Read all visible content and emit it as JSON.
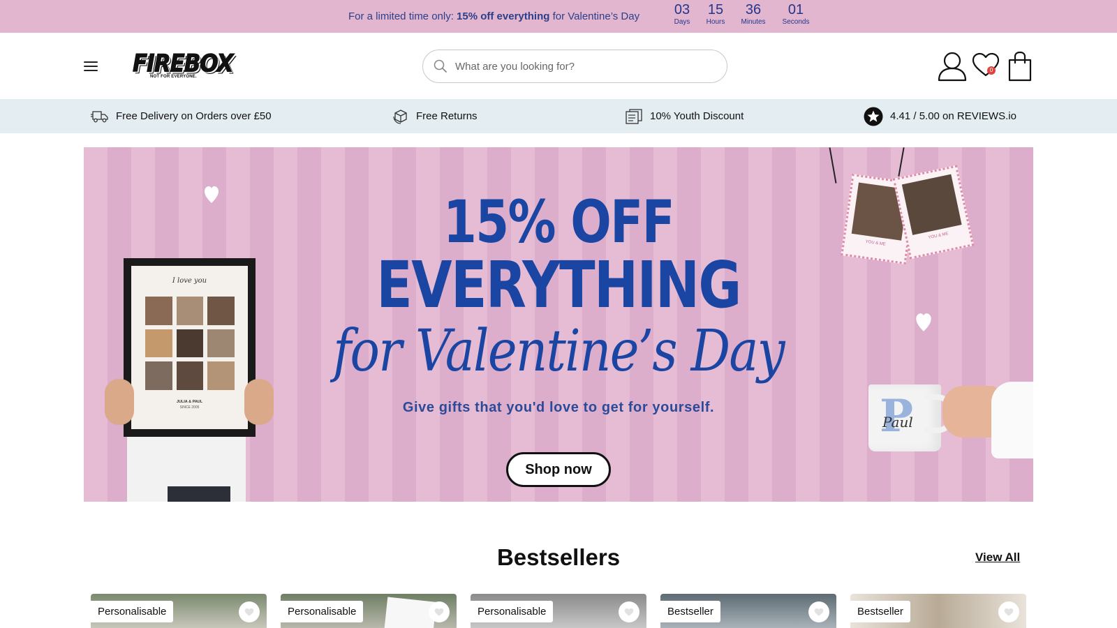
{
  "promo": {
    "text_before": "For a limited time only: ",
    "text_bold": "15% off everything",
    "text_after": " for Valentine’s Day",
    "countdown": [
      {
        "value": "03",
        "label": "Days"
      },
      {
        "value": "15",
        "label": "Hours"
      },
      {
        "value": "36",
        "label": "Minutes"
      },
      {
        "value": "01",
        "label": "Seconds"
      }
    ]
  },
  "header": {
    "logo_text": "FIREBOX",
    "logo_tagline": "NOT FOR EVERYONE.",
    "search_placeholder": "What are you looking for?",
    "wishlist_count": "0"
  },
  "usp": [
    {
      "icon": "delivery-truck-icon",
      "text": "Free Delivery on Orders over £50"
    },
    {
      "icon": "returns-box-icon",
      "text": "Free Returns"
    },
    {
      "icon": "youth-card-icon",
      "text": "10% Youth Discount"
    },
    {
      "icon": "star-badge-icon",
      "text": "4.41 / 5.00 on REVIEWS.io"
    }
  ],
  "hero": {
    "line1": "15% OFF",
    "line2": "EVERYTHING",
    "line3": "for Valentine’s Day",
    "subtitle": "Give gifts that you'd love to get for yourself.",
    "cta": "Shop now",
    "frame_caption": "I love you",
    "frame_names": "JULIA & PAUL",
    "frame_since": "SINCE 2005",
    "mug_name": "Paul",
    "mug_letter": "P",
    "tag_text": "YOU & ME"
  },
  "bestsellers": {
    "title": "Bestsellers",
    "view_all": "View All",
    "products": [
      {
        "badge": "Personalisable"
      },
      {
        "badge": "Personalisable"
      },
      {
        "badge": "Personalisable"
      },
      {
        "badge": "Bestseller"
      },
      {
        "badge": "Bestseller"
      }
    ]
  },
  "colors": {
    "promo_bg": "#e2b6cf",
    "promo_text": "#2b3f8a",
    "usp_bg": "#e4edf1",
    "hero_pink": "#e6bcd4",
    "hero_blue": "#1a45a3"
  }
}
